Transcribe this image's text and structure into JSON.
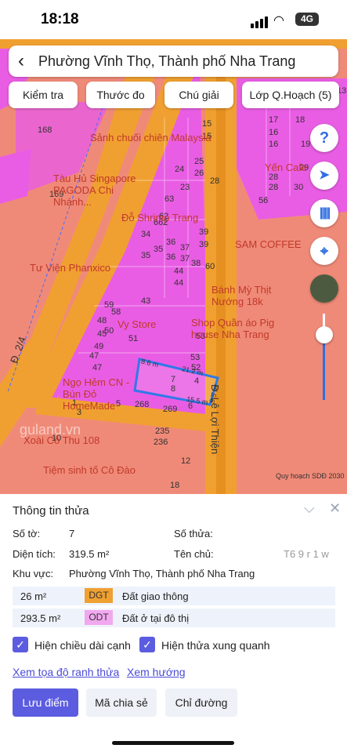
{
  "status_bar": {
    "time": "18:18",
    "network": "4G"
  },
  "header": {
    "title": "Phường Vĩnh Thọ, Thành phố Nha Trang"
  },
  "toolbar": {
    "check_label": "Kiểm tra",
    "measure_label": "Thước đo",
    "legend_label": "Chú giải",
    "layer_label": "Lớp Q.Hoạch (5)"
  },
  "side_buttons": {
    "help": "?",
    "compass": "compass",
    "barcode": "barcode",
    "location": "location",
    "satellite": "satellite"
  },
  "map": {
    "road_lelo": "Đ. Lê Lợi Thiện",
    "road_21": "Đ. 2/4",
    "poi": [
      "Sảnh chuối chiên Malaysia",
      "Tàu Hủ Singapore PAGODA Chi Nhánh...",
      "Đỗ Shrimp Trang",
      "SAM COFFEE",
      "Bánh Mỳ Thịt Nướng 18k",
      "Tư Viện Phanxico",
      "Vy Store",
      "Shop Quần áo Pig house Nha Trang",
      "Ngọ Hẻm CN - Bún Đỏ HomeMade",
      "Tiệm sinh tố Cô Đào",
      "Yến Cafe",
      "Xoài Cô Thu 108"
    ],
    "parcel_labels": [
      "168",
      "169",
      "15",
      "15",
      "25",
      "26",
      "24",
      "28",
      "63",
      "23",
      "62",
      "662",
      "34",
      "36",
      "37",
      "39",
      "35",
      "39",
      "35",
      "36",
      "37",
      "38",
      "60",
      "44",
      "44",
      "43",
      "59",
      "58",
      "48",
      "50",
      "45",
      "51",
      "49",
      "47",
      "53",
      "53",
      "47",
      "52",
      "4",
      "1",
      "3",
      "5",
      "8",
      "268",
      "269",
      "7",
      "6",
      "10",
      "235",
      "236",
      "12",
      "18",
      "17",
      "18",
      "16",
      "16",
      "29",
      "28",
      "28",
      "30",
      "56",
      "13",
      "19"
    ],
    "dimensions": {
      "top": "21.2 m",
      "left": "8.6 m",
      "right": "9.5 m",
      "bottom": "15.5 m"
    },
    "footer_note": "Quy hoạch SDĐ 2030",
    "watermark": "guland.vn"
  },
  "panel": {
    "title": "Thông tin thửa",
    "sheet_label": "Số tờ:",
    "sheet_value": "7",
    "parcel_label": "Số thửa:",
    "parcel_value": "",
    "area_label": "Diện tích:",
    "area_value": "319.5 m²",
    "owner_label": "Tên chủ:",
    "owner_value": "T6 9 r 1 w",
    "region_label": "Khu vực:",
    "region_value": "Phường Vĩnh Thọ, Thành phố Nha Trang",
    "zones": [
      {
        "area": "26 m²",
        "code": "DGT",
        "color": "#f0a030",
        "desc": "Đất giao thông"
      },
      {
        "area": "293.5 m²",
        "code": "ODT",
        "color": "#f2a8f0",
        "desc": "Đất ở tại đô thị"
      }
    ],
    "checkbox_edges": "Hiện chiều dài cạnh",
    "checkbox_neighbors": "Hiện thửa xung quanh",
    "link_coords": "Xem tọa độ ranh thửa",
    "link_direction": "Xem hướng",
    "btn_save": "Lưu điểm",
    "btn_share": "Mã chia sẻ",
    "btn_route": "Chỉ đường"
  }
}
